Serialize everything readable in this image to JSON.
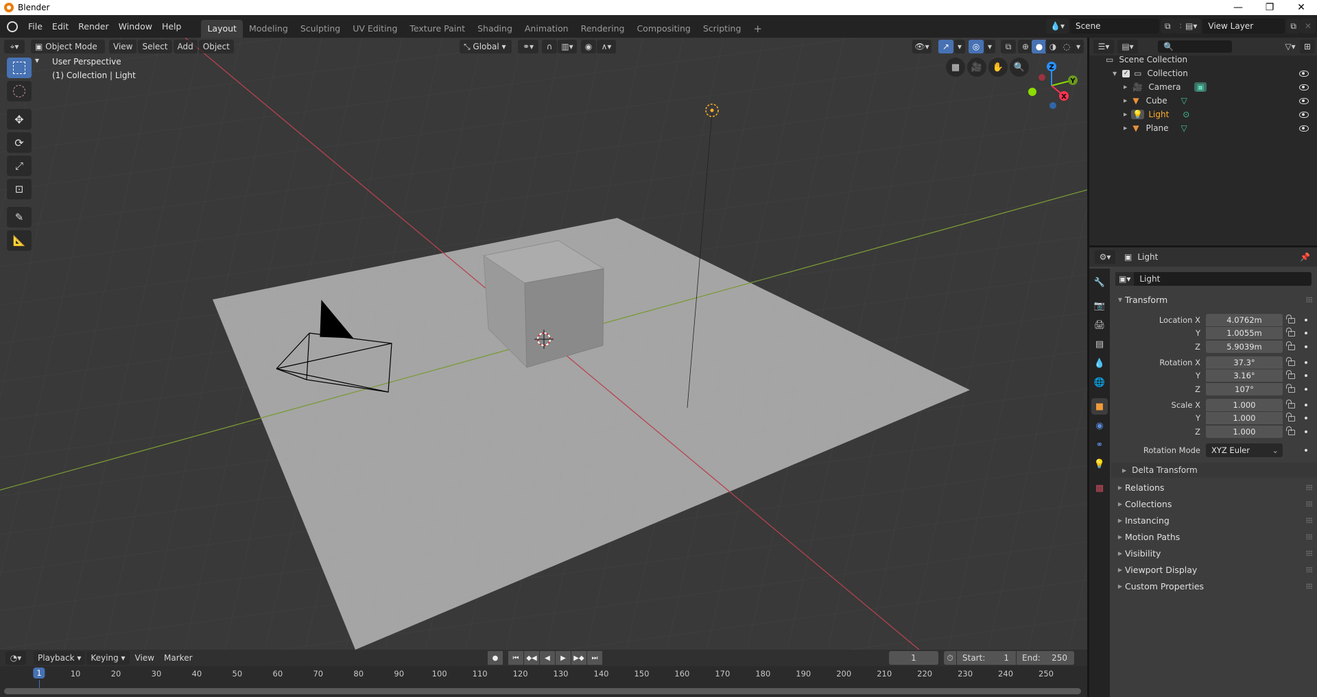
{
  "window": {
    "title": "Blender",
    "minimize": "—",
    "maximize": "❐",
    "close": "✕"
  },
  "menu": [
    "File",
    "Edit",
    "Render",
    "Window",
    "Help"
  ],
  "workspaces": [
    {
      "label": "Layout",
      "active": true
    },
    {
      "label": "Modeling"
    },
    {
      "label": "Sculpting"
    },
    {
      "label": "UV Editing"
    },
    {
      "label": "Texture Paint"
    },
    {
      "label": "Shading"
    },
    {
      "label": "Animation"
    },
    {
      "label": "Rendering"
    },
    {
      "label": "Compositing"
    },
    {
      "label": "Scripting"
    }
  ],
  "add_workspace": "+",
  "scene": {
    "name": "Scene",
    "view_layer": "View Layer"
  },
  "viewport_header": {
    "mode": "Object Mode",
    "menus": [
      "View",
      "Select",
      "Add",
      "Object"
    ],
    "orientation": "Global"
  },
  "viewport": {
    "view_name": "User Perspective",
    "context": "(1) Collection | Light",
    "gizmo": {
      "z": "Z",
      "y": "Y",
      "x": "X"
    }
  },
  "outliner": {
    "search_placeholder": "",
    "root": "Scene Collection",
    "collection": "Collection",
    "items": [
      {
        "name": "Camera",
        "type": "camera",
        "selected": false
      },
      {
        "name": "Cube",
        "type": "mesh",
        "selected": false
      },
      {
        "name": "Light",
        "type": "light",
        "selected": true
      },
      {
        "name": "Plane",
        "type": "mesh",
        "selected": false
      }
    ]
  },
  "properties": {
    "header_object": "Light",
    "object_name": "Light",
    "transform_label": "Transform",
    "location": {
      "label": "Location X",
      "x": "4.0762m",
      "y": "1.0055m",
      "z": "5.9039m"
    },
    "rotation": {
      "label": "Rotation X",
      "x": "37.3°",
      "y": "3.16°",
      "z": "107°"
    },
    "scale": {
      "label": "Scale X",
      "x": "1.000",
      "y": "1.000",
      "z": "1.000"
    },
    "axis_y": "Y",
    "axis_z": "Z",
    "rotation_mode_label": "Rotation Mode",
    "rotation_mode": "XYZ Euler",
    "delta_transform": "Delta Transform",
    "panels": [
      "Relations",
      "Collections",
      "Instancing",
      "Motion Paths",
      "Visibility",
      "Viewport Display",
      "Custom Properties"
    ]
  },
  "timeline": {
    "menus": [
      "Playback",
      "Keying",
      "View",
      "Marker"
    ],
    "current_frame": "1",
    "start_label": "Start:",
    "start": "1",
    "end_label": "End:",
    "end": "250",
    "ruler_ticks": [
      "1",
      "10",
      "20",
      "30",
      "40",
      "50",
      "60",
      "70",
      "80",
      "90",
      "100",
      "110",
      "120",
      "130",
      "140",
      "150",
      "160",
      "170",
      "180",
      "190",
      "200",
      "210",
      "220",
      "230",
      "240",
      "250"
    ]
  },
  "colors": {
    "accent": "#4772b3",
    "selected_text": "#ffaf29",
    "x_axis": "#ff3352",
    "y_axis": "#8bdc00",
    "z_axis": "#2890ff"
  }
}
